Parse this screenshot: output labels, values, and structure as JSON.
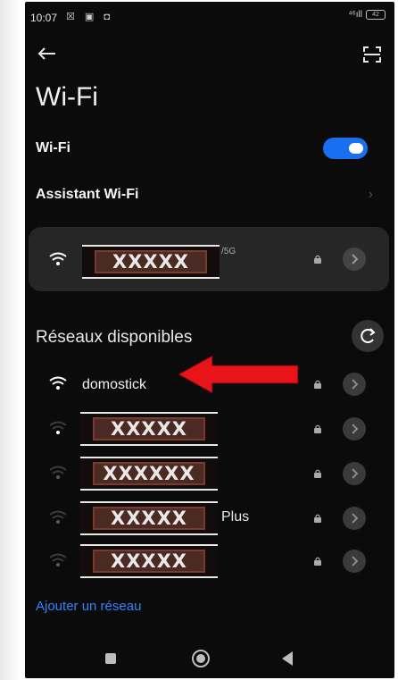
{
  "status_bar": {
    "time": "10:07",
    "left_icons": "☒ ▣ ◘",
    "signal_text": "⁴⁶ıll",
    "battery": "42"
  },
  "header": {
    "title": "Wi-Fi"
  },
  "settings": {
    "wifi_label": "Wi-Fi",
    "wifi_enabled": true,
    "assistant_label": "Assistant Wi-Fi"
  },
  "connected": {
    "visible_fragment": "/5G",
    "redaction_text": "XXXXX"
  },
  "available": {
    "section_title": "Réseaux disponibles",
    "networks": [
      {
        "name": "domostick",
        "redacted": false,
        "suffix": ""
      },
      {
        "name": "",
        "redacted": true,
        "redaction_text": "XXXXX",
        "suffix": ""
      },
      {
        "name": "",
        "redacted": true,
        "redaction_text": "XXXXXX",
        "suffix": ""
      },
      {
        "name": "",
        "redacted": true,
        "redaction_text": "XXXXX",
        "suffix": "Plus"
      },
      {
        "name": "",
        "redacted": true,
        "redaction_text": "XXXXX",
        "suffix": ""
      }
    ]
  },
  "add_network_label": "Ajouter un réseau",
  "colors": {
    "background": "#0b0b0b",
    "toggle_on": "#1a6ff0",
    "link": "#2f85ff",
    "annotation_arrow": "#e8141a"
  },
  "icons": {
    "back": "arrow-left-icon",
    "scan": "qr-scan-icon",
    "wifi": "wifi-icon",
    "lock": "lock-icon",
    "details": "chevron-right-icon",
    "refresh": "refresh-icon"
  }
}
